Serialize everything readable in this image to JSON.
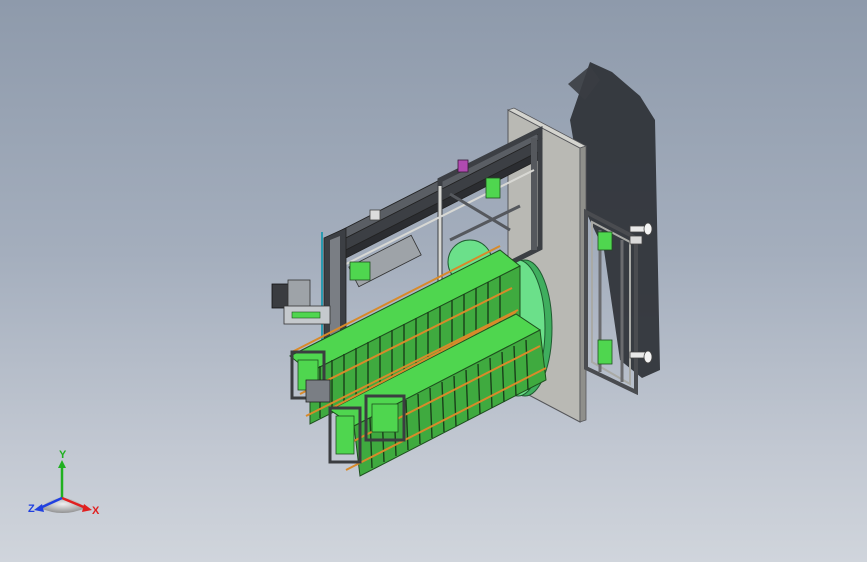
{
  "triad": {
    "x_label": "X",
    "y_label": "Y",
    "z_label": "Z"
  },
  "colors": {
    "background_top": "#8e9aab",
    "background_bottom": "#d0d5dc",
    "frame_gray": "#b9b9b4",
    "profile_dark": "#3c3f44",
    "part_green": "#4fd64f",
    "disk_green": "#6be08a",
    "shadow": "#2e3136",
    "rod_orange": "#d88a2a",
    "x_axis": "#e02020",
    "y_axis": "#20b020",
    "z_axis": "#2040e0"
  }
}
